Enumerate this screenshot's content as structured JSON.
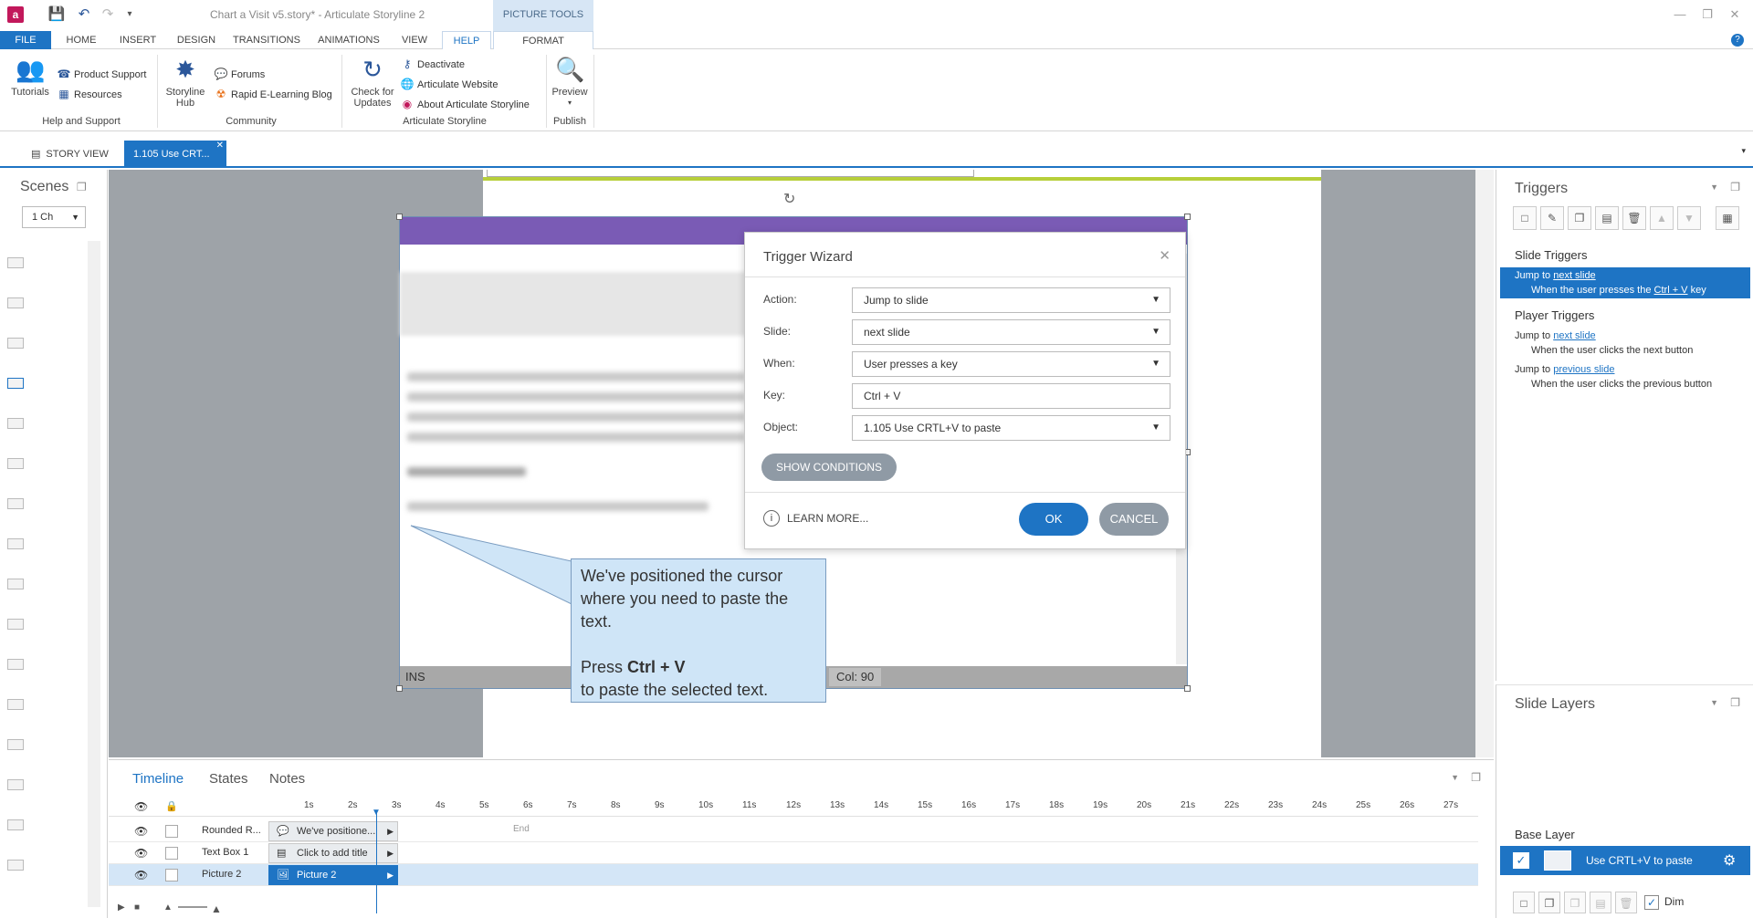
{
  "window": {
    "title": "Chart a Visit v5.story* - Articulate Storyline 2",
    "picture_tools": "PICTURE TOOLS"
  },
  "tabs": {
    "file": "FILE",
    "home": "HOME",
    "insert": "INSERT",
    "design": "DESIGN",
    "transitions": "TRANSITIONS",
    "animations": "ANIMATIONS",
    "view": "VIEW",
    "help": "HELP",
    "format": "FORMAT"
  },
  "ribbon": {
    "tutorials": "Tutorials",
    "product_support": "Product Support",
    "resources": "Resources",
    "help_support_group": "Help and Support",
    "storyline_hub_1": "Storyline",
    "storyline_hub_2": "Hub",
    "forums": "Forums",
    "blog": "Rapid E-Learning Blog",
    "community_group": "Community",
    "check_updates_1": "Check for",
    "check_updates_2": "Updates",
    "deactivate": "Deactivate",
    "website": "Articulate Website",
    "about": "About Articulate Storyline",
    "articulate_group": "Articulate Storyline",
    "preview": "Preview",
    "publish_group": "Publish"
  },
  "doctabs": {
    "story_view": "STORY VIEW",
    "slide_tab": "1.105 Use CRT..."
  },
  "scenes": {
    "title": "Scenes",
    "dropdown": "1 Ch"
  },
  "picture": {
    "status_ins": "INS",
    "status_col": "Col: 90"
  },
  "wizard": {
    "title": "Trigger Wizard",
    "action_label": "Action:",
    "action_value": "Jump to slide",
    "slide_label": "Slide:",
    "slide_value": "next slide",
    "when_label": "When:",
    "when_value": "User presses a key",
    "key_label": "Key:",
    "key_value": "Ctrl + V",
    "object_label": "Object:",
    "object_value": "1.105 Use CRTL+V to paste",
    "show_conditions": "SHOW CONDITIONS",
    "learn_more": "LEARN MORE...",
    "ok": "OK",
    "cancel": "CANCEL"
  },
  "callout": {
    "line1": "We've positioned the cursor where you need to paste the text.",
    "press": "Press",
    "keys": "Ctrl + V",
    "line2": "to paste the selected text."
  },
  "triggers": {
    "title": "Triggers",
    "slide_triggers": "Slide Triggers",
    "player_triggers": "Player Triggers",
    "t1_jump": "Jump to",
    "t1_target": "next slide",
    "t1_when": "When the user presses the",
    "t1_key": "Ctrl + V",
    "t1_key_suffix": "key",
    "t2_jump": "Jump to",
    "t2_target": "next slide",
    "t2_when": "When the user clicks the next button",
    "t3_jump": "Jump to",
    "t3_target": "previous slide",
    "t3_when": "When the user clicks the previous button"
  },
  "layers": {
    "title": "Slide Layers",
    "base_layer": "Base Layer",
    "base_layer_name": "Use CRTL+V to paste",
    "dim": "Dim"
  },
  "timeline": {
    "tab_timeline": "Timeline",
    "tab_states": "States",
    "tab_notes": "Notes",
    "ticks": [
      "1s",
      "2s",
      "3s",
      "4s",
      "5s",
      "6s",
      "7s",
      "8s",
      "9s",
      "10s",
      "11s",
      "12s",
      "13s",
      "14s",
      "15s",
      "16s",
      "17s",
      "18s",
      "19s",
      "20s",
      "21s",
      "22s",
      "23s",
      "24s",
      "25s",
      "26s",
      "27s"
    ],
    "end_label": "End",
    "rows": [
      {
        "name": "Rounded R...",
        "bar": "We've positione..."
      },
      {
        "name": "Text Box 1",
        "bar": "Click to add title"
      },
      {
        "name": "Picture 2",
        "bar": "Picture 2"
      }
    ]
  },
  "colors": {
    "accent": "#1e74c4",
    "header_purple": "#7a5bb5",
    "callout_fill": "#cfe5f7",
    "slide_line": "#b7cf3a"
  }
}
